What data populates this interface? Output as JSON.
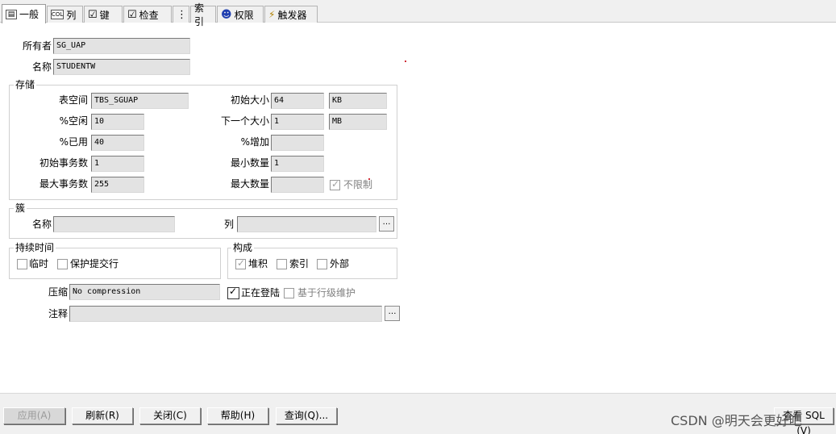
{
  "tabs": [
    {
      "label": "一般",
      "icon": "general-icon",
      "glyph": "▤"
    },
    {
      "label": "列",
      "icon": "columns-icon",
      "glyph": "COL"
    },
    {
      "label": "键",
      "icon": "key-check-icon",
      "glyph": "☑"
    },
    {
      "label": "检查",
      "icon": "check-constraint-icon",
      "glyph": "☑"
    },
    {
      "label": "",
      "icon": "partition-icon",
      "glyph": "⋮"
    },
    {
      "label": "索引",
      "icon": "index-icon",
      "glyph": "⊞"
    },
    {
      "label": "权限",
      "icon": "privileges-icon",
      "glyph": "☻"
    },
    {
      "label": "触发器",
      "icon": "trigger-icon",
      "glyph": "⚡"
    }
  ],
  "general": {
    "owner_label": "所有者",
    "owner_value": "SG_UAP",
    "name_label": "名称",
    "name_value": "STUDENTW"
  },
  "storage": {
    "title": "存储",
    "tablespace_label": "表空间",
    "tablespace_value": "TBS_SGUAP",
    "pct_free_label": "%空闲",
    "pct_free_value": "10",
    "pct_used_label": "%已用",
    "pct_used_value": "40",
    "initrans_label": "初始事务数",
    "initrans_value": "1",
    "maxtrans_label": "最大事务数",
    "maxtrans_value": "255",
    "initial_label": "初始大小",
    "initial_value": "64",
    "initial_unit": "KB",
    "next_label": "下一个大小",
    "next_value": "1",
    "next_unit": "MB",
    "pct_increase_label": "%增加",
    "pct_increase_value": "",
    "minext_label": "最小数量",
    "minext_value": "1",
    "maxext_label": "最大数量",
    "maxext_value": "",
    "unlimited_label": "不限制"
  },
  "cluster": {
    "title": "簇",
    "name_label": "名称",
    "name_value": "",
    "columns_label": "列",
    "columns_value": ""
  },
  "duration": {
    "title": "持续时间",
    "temporary_label": "临时",
    "preserve_label": "保护提交行"
  },
  "organization": {
    "title": "构成",
    "heap_label": "堆积",
    "index_label": "索引",
    "external_label": "外部"
  },
  "compress_label": "压缩",
  "compress_value": "No compression",
  "logging_label": "正在登陆",
  "rowmovement_label": "基于行级维护",
  "comment_label": "注释",
  "comment_value": "",
  "buttons": {
    "apply": "应用(A)",
    "refresh": "刷新(R)",
    "close": "关闭(C)",
    "help": "帮助(H)",
    "query": "查询(Q)...",
    "view_sql": "查看 SQL (V)"
  },
  "watermark": "CSDN @明天会更好吧"
}
